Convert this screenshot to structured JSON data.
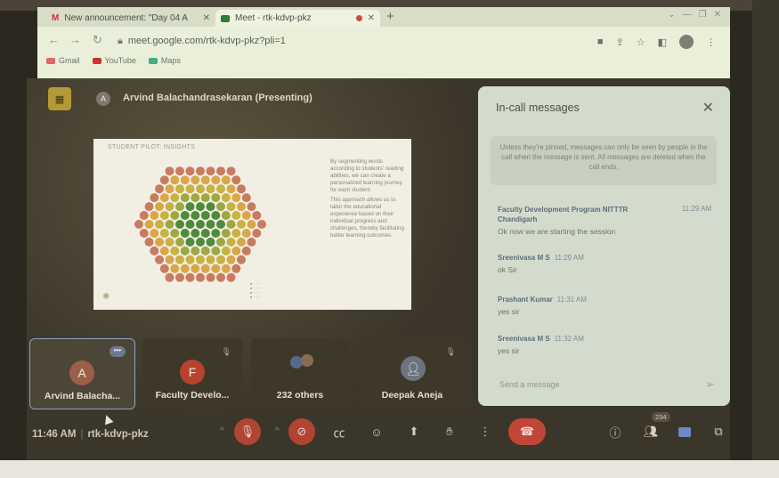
{
  "browser": {
    "tabs": [
      {
        "label": "New announcement: \"Day 04 A",
        "favicon": "gmail-icon"
      },
      {
        "label": "Meet - rtk-kdvp-pkz",
        "favicon": "meet-icon"
      }
    ],
    "url": "meet.google.com/rtk-kdvp-pkz?pli=1",
    "bookmarks": [
      "Gmail",
      "YouTube",
      "Maps"
    ]
  },
  "meet": {
    "presenter_initial": "A",
    "presenter_label": "Arvind Balachandrasekaran (Presenting)",
    "slide": {
      "title": "STUDENT PILOT: INSIGHTS",
      "paragraph1": "By segmenting words according to students' reading abilities, we can create a personalized learning journey for each student.",
      "paragraph2": "This approach allows us to tailor the educational experience based on their individual progress and challenges, thereby facilitating better learning outcomes."
    },
    "participants": [
      {
        "initial": "A",
        "name": "Arvind Balacha...",
        "color": "#9b5e48"
      },
      {
        "initial": "F",
        "name": "Faculty Develo...",
        "color": "#b8412f"
      },
      {
        "name": "232 others"
      },
      {
        "name": "Deepak Aneja"
      }
    ],
    "time": "11:46 AM",
    "meeting_code": "rtk-kdvp-pkz",
    "participant_count": "234"
  },
  "chat": {
    "title": "In-call messages",
    "note": "Unless they're pinned, messages can only be seen by people in the call when the message is sent. All messages are deleted when the call ends.",
    "messages": [
      {
        "from": "Faculty Development Program NITTTR Chandigarh",
        "time": "11:29 AM",
        "text": "Ok now we are starting the session"
      },
      {
        "from": "Sreenivasa M S",
        "time": "11:29 AM",
        "text": "ok Sir"
      },
      {
        "from": "Prashant Kumar",
        "time": "11:31 AM",
        "text": "yes sir"
      },
      {
        "from": "Sreenivasa M S",
        "time": "11:32 AM",
        "text": "yes sir"
      }
    ],
    "input_placeholder": "Send a message"
  },
  "colors": {
    "end_call": "#c24638",
    "hex_center": "#4f8b3a",
    "hex_outer": "#c97b5f"
  }
}
